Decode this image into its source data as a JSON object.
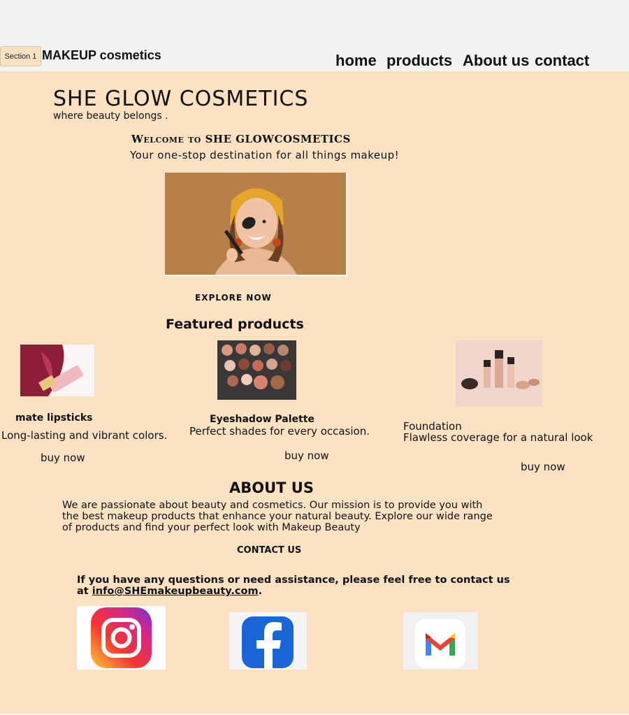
{
  "header": {
    "section_button": "Section 1",
    "brand": "MAKEUP cosmetics",
    "nav": [
      {
        "label": "home"
      },
      {
        "label": "products"
      },
      {
        "label": "About us"
      },
      {
        "label": "contact"
      }
    ]
  },
  "hero": {
    "title": "SHE GLOW COSMETICS",
    "tagline": "where beauty belongs .",
    "welcome": "Welcome to SHE GLOWCOSMETICS",
    "welcome_sub": "Your one-stop destination for all things makeup!",
    "explore": "EXPLORE NOW"
  },
  "featured": {
    "title": "Featured products",
    "products": [
      {
        "name": "mate lipsticks",
        "desc": "Long-lasting and vibrant colors.",
        "buy": "buy now"
      },
      {
        "name": "Eyeshadow Palette",
        "desc": "Perfect shades for every occasion.",
        "buy": "buy now"
      },
      {
        "name": "Foundation",
        "desc": "Flawless coverage for a natural look",
        "buy": "buy now"
      }
    ]
  },
  "about": {
    "title": "ABOUT US",
    "text": "We are passionate about beauty and cosmetics. Our mission is to provide you with the best makeup products that enhance your natural beauty. Explore our wide range of products and find your perfect look with Makeup Beauty"
  },
  "contact": {
    "title": "CONTACT US",
    "text": "If you have any questions or need assistance, please feel free to contact us at",
    "email": "info@SHEmakeupbeauty.com",
    "end": "."
  },
  "icons": {
    "instagram": "instagram-icon",
    "facebook": "facebook-icon",
    "gmail": "gmail-icon"
  },
  "colors": {
    "background": "#f9e1c2",
    "header": "#f2f2f3"
  }
}
